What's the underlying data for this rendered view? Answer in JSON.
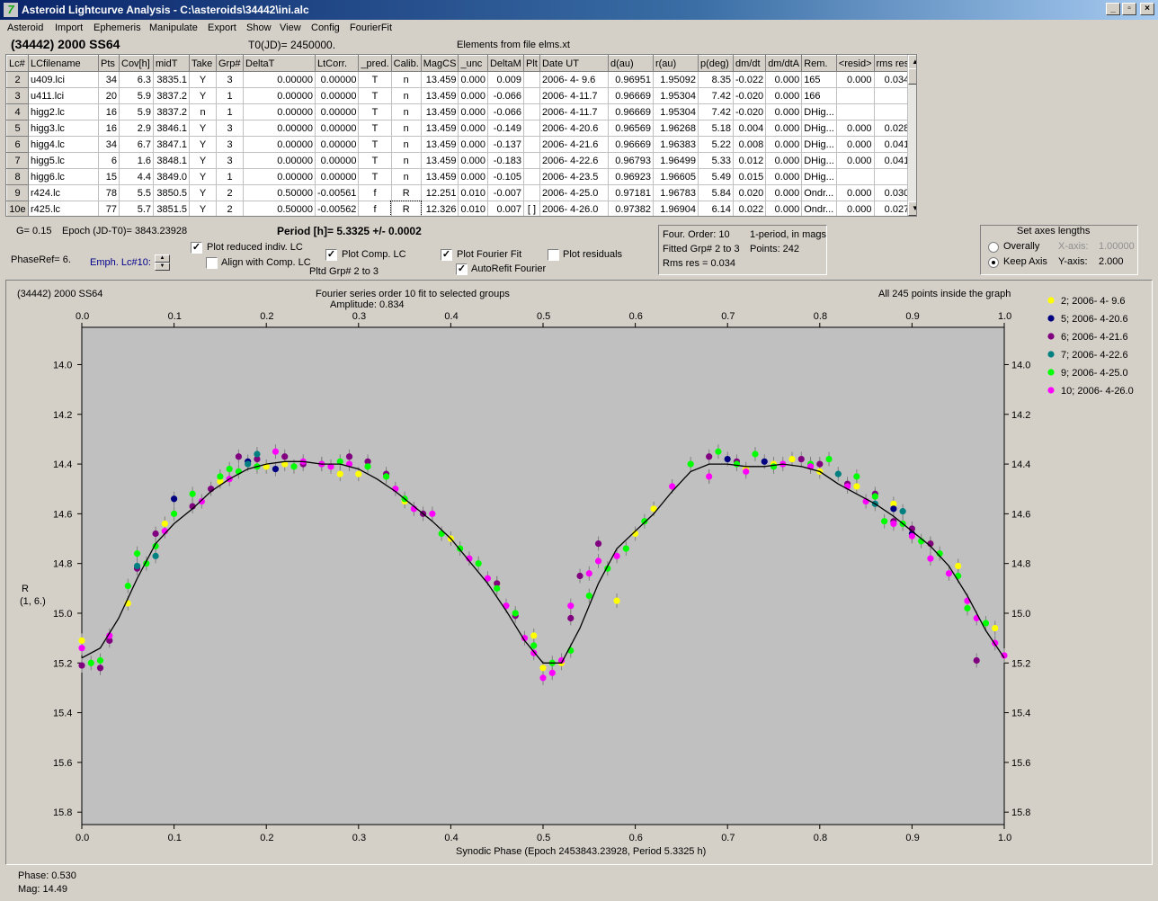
{
  "window": {
    "title": "Asteroid Lightcurve Analysis - C:\\asteroids\\34442\\ini.alc"
  },
  "window_buttons": {
    "minimize": "_",
    "restore": "▫",
    "close": "×"
  },
  "menu": [
    "Asteroid",
    "Import",
    "Ephemeris",
    "Manipulate",
    "Export",
    "Show",
    "View",
    "Config",
    "FourierFit"
  ],
  "header": {
    "asteroid": "(34442) 2000 SS64",
    "t0": "T0(JD)= 2450000.",
    "elements": "Elements from file elms.xt"
  },
  "table": {
    "columns": [
      "Lc#",
      "LCfilename",
      "Pts",
      "Cov[h]",
      "midT",
      "Take",
      "Grp#",
      "DeltaT",
      "LtCorr.",
      "_pred.",
      "Calib.",
      "MagCS",
      "_unc",
      "DeltaM",
      "Plt",
      "Date UT",
      "d(au)",
      "r(au)",
      "p(deg)",
      "dm/dt",
      "dm/dtA",
      "Rem.",
      "<resid>",
      "rms res"
    ],
    "rows": [
      [
        "2",
        "u409.lci",
        "34",
        "6.3",
        "3835.1",
        "Y",
        "3",
        "0.00000",
        "0.00000",
        "T",
        "n",
        "13.459",
        "0.000",
        "0.009",
        "",
        "2006- 4- 9.6",
        "0.96951",
        "1.95092",
        "8.35",
        "-0.022",
        "0.000",
        "165",
        "0.000",
        "0.034"
      ],
      [
        "3",
        "u411.lci",
        "20",
        "5.9",
        "3837.2",
        "Y",
        "1",
        "0.00000",
        "0.00000",
        "T",
        "n",
        "13.459",
        "0.000",
        "-0.066",
        "",
        "2006- 4-11.7",
        "0.96669",
        "1.95304",
        "7.42",
        "-0.020",
        "0.000",
        "166",
        "",
        ""
      ],
      [
        "4",
        "higg2.lc",
        "16",
        "5.9",
        "3837.2",
        "n",
        "1",
        "0.00000",
        "0.00000",
        "T",
        "n",
        "13.459",
        "0.000",
        "-0.066",
        "",
        "2006- 4-11.7",
        "0.96669",
        "1.95304",
        "7.42",
        "-0.020",
        "0.000",
        "DHig...",
        "",
        ""
      ],
      [
        "5",
        "higg3.lc",
        "16",
        "2.9",
        "3846.1",
        "Y",
        "3",
        "0.00000",
        "0.00000",
        "T",
        "n",
        "13.459",
        "0.000",
        "-0.149",
        "",
        "2006- 4-20.6",
        "0.96569",
        "1.96268",
        "5.18",
        "0.004",
        "0.000",
        "DHig...",
        "0.000",
        "0.028"
      ],
      [
        "6",
        "higg4.lc",
        "34",
        "6.7",
        "3847.1",
        "Y",
        "3",
        "0.00000",
        "0.00000",
        "T",
        "n",
        "13.459",
        "0.000",
        "-0.137",
        "",
        "2006- 4-21.6",
        "0.96669",
        "1.96383",
        "5.22",
        "0.008",
        "0.000",
        "DHig...",
        "0.000",
        "0.041"
      ],
      [
        "7",
        "higg5.lc",
        "6",
        "1.6",
        "3848.1",
        "Y",
        "3",
        "0.00000",
        "0.00000",
        "T",
        "n",
        "13.459",
        "0.000",
        "-0.183",
        "",
        "2006- 4-22.6",
        "0.96793",
        "1.96499",
        "5.33",
        "0.012",
        "0.000",
        "DHig...",
        "0.000",
        "0.041"
      ],
      [
        "8",
        "higg6.lc",
        "15",
        "4.4",
        "3849.0",
        "Y",
        "1",
        "0.00000",
        "0.00000",
        "T",
        "n",
        "13.459",
        "0.000",
        "-0.105",
        "",
        "2006- 4-23.5",
        "0.96923",
        "1.96605",
        "5.49",
        "0.015",
        "0.000",
        "DHig...",
        "",
        ""
      ],
      [
        "9",
        "r424.lc",
        "78",
        "5.5",
        "3850.5",
        "Y",
        "2",
        "0.50000",
        "-0.00561",
        "f",
        "R",
        "12.251",
        "0.010",
        "-0.007",
        "",
        "2006- 4-25.0",
        "0.97181",
        "1.96783",
        "5.84",
        "0.020",
        "0.000",
        "Ondr...",
        "0.000",
        "0.030"
      ],
      [
        "10e",
        "r425.lc",
        "77",
        "5.7",
        "3851.5",
        "Y",
        "2",
        "0.50000",
        "-0.00562",
        "f",
        "R",
        "12.326",
        "0.010",
        "0.007",
        "[ ]",
        "2006- 4-26.0",
        "0.97382",
        "1.96904",
        "6.14",
        "0.022",
        "0.000",
        "Ondr...",
        "0.000",
        "0.027"
      ]
    ]
  },
  "controls": {
    "g_value": "G= 0.15",
    "epoch": "Epoch (JD-T0)= 3843.23928",
    "period": "Period [h]= 5.3325 +/- 0.0002",
    "phaseref": "PhaseRef= 6.",
    "emph": "Emph. Lc#10:",
    "plot_reduced": "Plot reduced indiv. LC",
    "align_comp": "Align with Comp. LC",
    "plot_comp": "Plot Comp. LC",
    "pltd_grp": "Pltd Grp#  2  to   3",
    "plot_fourier": "Plot Fourier Fit",
    "autorefit": "AutoRefit Fourier",
    "plot_residuals": "Plot residuals",
    "plot_reduced_checked": true,
    "align_comp_checked": false,
    "plot_comp_checked": true,
    "plot_fourier_checked": true,
    "autorefit_checked": true,
    "plot_residuals_checked": false
  },
  "fourier_info": {
    "order": "Four. Order: 10",
    "period_mode": "1-period, in mags",
    "fitted": "Fitted Grp# 2 to 3",
    "points": "Points: 242",
    "rms": "Rms res      = 0.034"
  },
  "axes_box": {
    "title": "Set axes lengths",
    "overally": "Overally",
    "keep_axis": "Keep Axis",
    "x_axis_label": "X-axis:",
    "x_axis_value": "1.00000",
    "y_axis_label": "Y-axis:",
    "y_axis_value": "2.000",
    "selected": "keep_axis"
  },
  "plot": {
    "corner_title": "(34442) 2000 SS64",
    "fit_title": "Fourier series order 10 fit to selected groups",
    "amplitude": "Amplitude: 0.834",
    "inside": "All 245 points inside the graph",
    "ylabel_line1": "R",
    "ylabel_line2": "(1, 6.)",
    "xlabel": "Synodic Phase (Epoch 2453843.23928, Period 5.3325 h)"
  },
  "status": {
    "phase": "Phase:  0.530",
    "mag": "Mag:    14.49"
  },
  "chart_data": {
    "type": "scatter",
    "xlabel": "Synodic Phase (Epoch 2453843.23928, Period 5.3325 h)",
    "ylabel": "R (1, 6.)",
    "xlim": [
      0.0,
      1.0
    ],
    "ylim": [
      15.85,
      13.85
    ],
    "y_inverted": true,
    "xticks": [
      0.0,
      0.1,
      0.2,
      0.3,
      0.4,
      0.5,
      0.6,
      0.7,
      0.8,
      0.9,
      1.0
    ],
    "yticks": [
      14.0,
      14.2,
      14.4,
      14.6,
      14.8,
      15.0,
      15.2,
      15.4,
      15.6,
      15.8
    ],
    "legend_position": "right",
    "fit_curve": {
      "x": [
        0.0,
        0.02,
        0.04,
        0.06,
        0.08,
        0.1,
        0.12,
        0.14,
        0.16,
        0.18,
        0.2,
        0.22,
        0.24,
        0.26,
        0.28,
        0.3,
        0.32,
        0.34,
        0.36,
        0.38,
        0.4,
        0.42,
        0.44,
        0.46,
        0.48,
        0.5,
        0.52,
        0.54,
        0.56,
        0.58,
        0.6,
        0.62,
        0.64,
        0.66,
        0.68,
        0.7,
        0.72,
        0.74,
        0.76,
        0.78,
        0.8,
        0.82,
        0.84,
        0.86,
        0.88,
        0.9,
        0.92,
        0.94,
        0.96,
        0.98,
        1.0
      ],
      "y": [
        15.18,
        15.14,
        15.02,
        14.86,
        14.72,
        14.64,
        14.58,
        14.51,
        14.46,
        14.42,
        14.4,
        14.39,
        14.39,
        14.4,
        14.4,
        14.42,
        14.46,
        14.51,
        14.57,
        14.63,
        14.7,
        14.79,
        14.88,
        14.99,
        15.11,
        15.2,
        15.2,
        15.06,
        14.88,
        14.74,
        14.67,
        14.6,
        14.51,
        14.43,
        14.4,
        14.4,
        14.41,
        14.41,
        14.4,
        14.41,
        14.43,
        14.48,
        14.52,
        14.56,
        14.61,
        14.67,
        14.73,
        14.81,
        14.93,
        15.07,
        15.18
      ]
    },
    "series": [
      {
        "name": "2; 2006- 4- 9.6",
        "color": "#ffff00",
        "x": [
          0.0,
          0.05,
          0.09,
          0.15,
          0.2,
          0.22,
          0.28,
          0.3,
          0.35,
          0.4,
          0.45,
          0.49,
          0.5,
          0.52,
          0.58,
          0.6,
          0.62,
          0.68,
          0.72,
          0.75,
          0.77,
          0.8,
          0.84,
          0.88,
          0.9,
          0.92,
          0.95,
          0.99
        ],
        "y": [
          15.11,
          14.96,
          14.64,
          14.47,
          14.41,
          14.4,
          14.44,
          14.44,
          14.55,
          14.7,
          14.88,
          15.09,
          15.22,
          15.2,
          14.95,
          14.68,
          14.58,
          14.45,
          14.42,
          14.4,
          14.38,
          14.43,
          14.49,
          14.56,
          14.69,
          14.72,
          14.81,
          15.06
        ]
      },
      {
        "name": "5; 2006- 4-20.6",
        "color": "#000080",
        "x": [
          0.1,
          0.18,
          0.21,
          0.7,
          0.74,
          0.88,
          0.9
        ],
        "y": [
          14.54,
          14.39,
          14.42,
          14.38,
          14.39,
          14.58,
          14.68
        ]
      },
      {
        "name": "6; 2006- 4-21.6",
        "color": "#800080",
        "x": [
          0.0,
          0.02,
          0.03,
          0.06,
          0.08,
          0.12,
          0.14,
          0.17,
          0.19,
          0.22,
          0.24,
          0.29,
          0.31,
          0.33,
          0.37,
          0.45,
          0.47,
          0.53,
          0.54,
          0.56,
          0.68,
          0.71,
          0.78,
          0.8,
          0.83,
          0.86,
          0.88,
          0.9,
          0.92,
          0.97
        ],
        "y": [
          15.21,
          15.22,
          15.11,
          14.82,
          14.68,
          14.57,
          14.5,
          14.37,
          14.38,
          14.37,
          14.4,
          14.37,
          14.39,
          14.44,
          14.6,
          14.88,
          15.01,
          15.02,
          14.85,
          14.72,
          14.37,
          14.39,
          14.38,
          14.4,
          14.48,
          14.52,
          14.63,
          14.66,
          14.72,
          15.19
        ]
      },
      {
        "name": "7; 2006- 4-22.6",
        "color": "#008080",
        "x": [
          0.06,
          0.08,
          0.18,
          0.19,
          0.82,
          0.86,
          0.89
        ],
        "y": [
          14.81,
          14.77,
          14.4,
          14.36,
          14.44,
          14.56,
          14.59
        ]
      },
      {
        "name": "9; 2006- 4-25.0",
        "color": "#00ff00",
        "x": [
          0.01,
          0.02,
          0.05,
          0.06,
          0.07,
          0.08,
          0.1,
          0.12,
          0.15,
          0.16,
          0.17,
          0.19,
          0.23,
          0.26,
          0.28,
          0.31,
          0.33,
          0.35,
          0.39,
          0.41,
          0.43,
          0.45,
          0.47,
          0.49,
          0.51,
          0.53,
          0.55,
          0.57,
          0.59,
          0.61,
          0.66,
          0.69,
          0.71,
          0.73,
          0.75,
          0.79,
          0.81,
          0.84,
          0.86,
          0.87,
          0.89,
          0.91,
          0.93,
          0.95,
          0.96,
          0.98
        ],
        "y": [
          15.2,
          15.19,
          14.89,
          14.76,
          14.8,
          14.73,
          14.6,
          14.52,
          14.45,
          14.42,
          14.43,
          14.41,
          14.41,
          14.4,
          14.39,
          14.41,
          14.45,
          14.54,
          14.68,
          14.74,
          14.8,
          14.9,
          15.0,
          15.13,
          15.2,
          15.15,
          14.93,
          14.82,
          14.74,
          14.63,
          14.4,
          14.35,
          14.4,
          14.36,
          14.41,
          14.4,
          14.38,
          14.45,
          14.53,
          14.63,
          14.64,
          14.71,
          14.76,
          14.85,
          14.98,
          15.04
        ]
      },
      {
        "name": "10; 2006- 4-26.0",
        "color": "#ff00ff",
        "x": [
          0.0,
          0.03,
          0.09,
          0.13,
          0.16,
          0.21,
          0.24,
          0.26,
          0.27,
          0.29,
          0.34,
          0.36,
          0.38,
          0.42,
          0.44,
          0.46,
          0.48,
          0.49,
          0.5,
          0.51,
          0.52,
          0.53,
          0.55,
          0.56,
          0.58,
          0.64,
          0.68,
          0.72,
          0.76,
          0.79,
          0.83,
          0.85,
          0.88,
          0.9,
          0.92,
          0.94,
          0.96,
          0.97,
          0.99,
          1.0
        ],
        "y": [
          15.14,
          15.09,
          14.67,
          14.55,
          14.46,
          14.35,
          14.39,
          14.4,
          14.41,
          14.4,
          14.5,
          14.58,
          14.6,
          14.78,
          14.86,
          14.97,
          15.1,
          15.16,
          15.26,
          15.24,
          15.19,
          14.97,
          14.84,
          14.79,
          14.77,
          14.49,
          14.45,
          14.43,
          14.4,
          14.41,
          14.49,
          14.55,
          14.64,
          14.69,
          14.78,
          14.84,
          14.95,
          15.02,
          15.12,
          15.17
        ]
      }
    ]
  }
}
